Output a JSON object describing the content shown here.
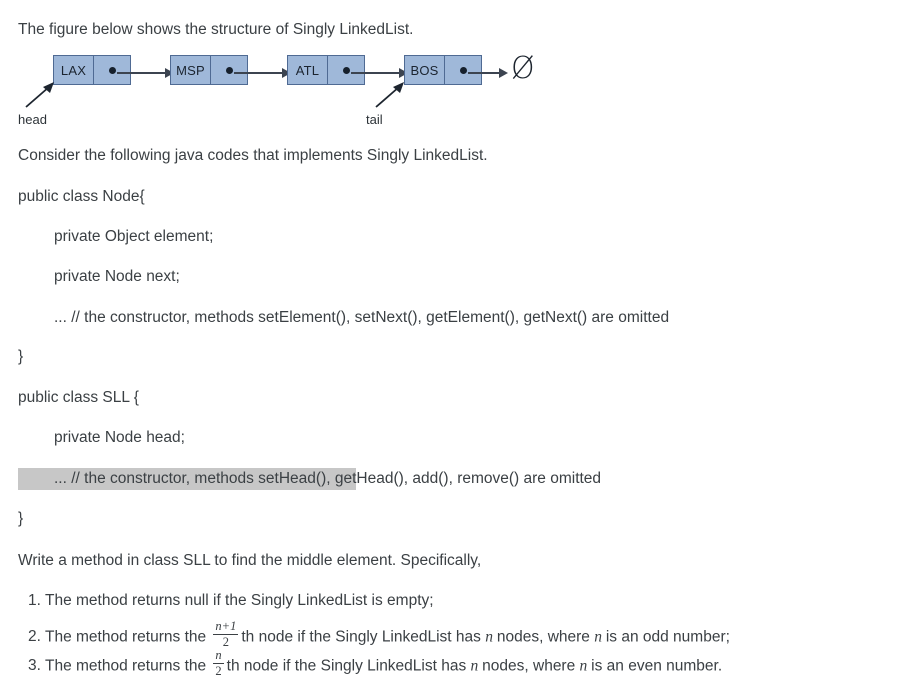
{
  "intro": {
    "figure_caption": "The figure below shows the structure of Singly LinkedList.",
    "code_caption": "Consider the following java codes that implements Singly LinkedList."
  },
  "figure": {
    "nodes": [
      {
        "value": "LAX",
        "pointer_glyph": "filled-dot"
      },
      {
        "value": "MSP",
        "pointer_glyph": "filled-dot"
      },
      {
        "value": "ATL",
        "pointer_glyph": "filled-dot"
      },
      {
        "value": "BOS",
        "pointer_glyph": "filled-dot"
      }
    ],
    "null_symbol": "Ø",
    "head_label": "head",
    "tail_label": "tail",
    "node_fill": "#9fb8d9",
    "node_border": "#4f6a93",
    "arrow_color": "#3c4450"
  },
  "code": {
    "node_class": {
      "line1": "public class Node{",
      "line2": "private Object element;",
      "line3": "private Node next;",
      "line4": "... // the constructor, methods setElement(), setNext(), getElement(), getNext() are omitted",
      "line5": "}"
    },
    "sll_class": {
      "line1": "public class SLL {",
      "line2": "private Node head;",
      "line3_selected": "... // the constructor, methods setHead(), get",
      "line3_rest": "Head(), add(), remove() are omitted",
      "line4": "}"
    },
    "selection_color": "#c7c7c7"
  },
  "task": {
    "prompt": "Write a method in class SLL to find the middle element. Specifically,",
    "items": [
      {
        "number": "1.",
        "before": "The method returns null if the Singly LinkedList is empty;",
        "fraction": null,
        "after": ""
      },
      {
        "number": "2.",
        "before": "The method returns the",
        "fraction": {
          "numerator": "n+1",
          "denominator": "2"
        },
        "after_parts": {
          "a": "th node if the Singly LinkedList has",
          "var1": "n",
          "b": "nodes, where",
          "var2": "n",
          "c": "is an odd number;"
        }
      },
      {
        "number": "3.",
        "before": "The method returns the",
        "fraction": {
          "numerator": "n",
          "denominator": "2"
        },
        "after_parts": {
          "a": "th node if the Singly LinkedList has",
          "var1": "n",
          "b": "nodes, where",
          "var2": "n",
          "c": "is an even number."
        }
      }
    ]
  }
}
